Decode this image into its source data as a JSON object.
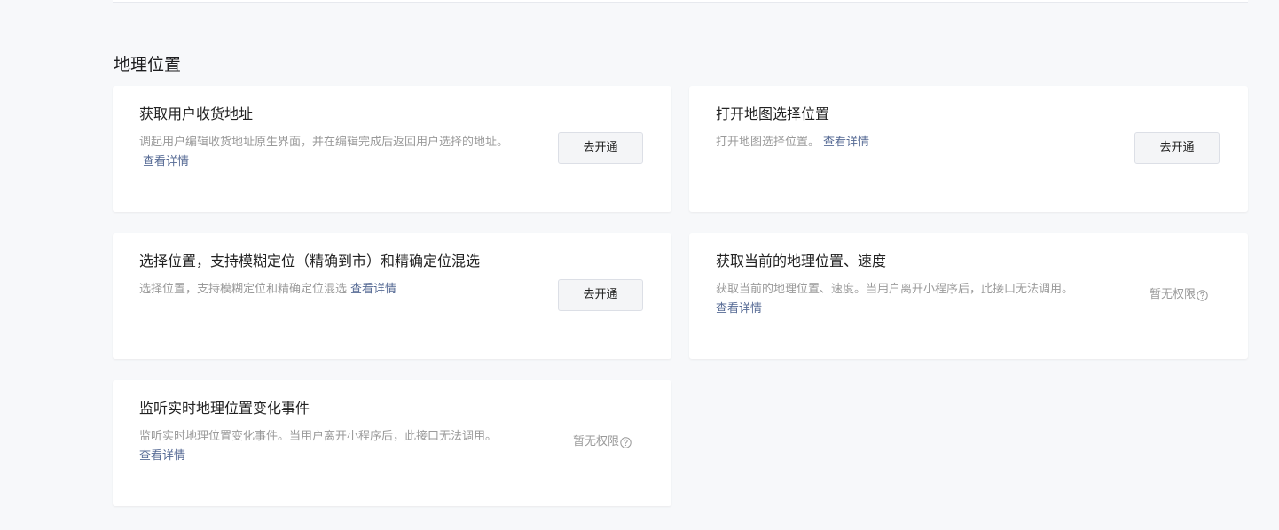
{
  "section": {
    "title": "地理位置"
  },
  "cards": [
    {
      "title": "获取用户收货地址",
      "desc": "调起用户编辑收货地址原生界面，并在编辑完成后返回用户选择的地址。",
      "link": "查看详情",
      "button": "去开通"
    },
    {
      "title": "打开地图选择位置",
      "desc": "打开地图选择位置。",
      "link": "查看详情",
      "button": "去开通"
    },
    {
      "title": "选择位置，支持模糊定位（精确到市）和精确定位混选",
      "desc": "选择位置，支持模糊定位和精确定位混选",
      "link": "查看详情",
      "button": "去开通"
    },
    {
      "title": "获取当前的地理位置、速度",
      "desc": "获取当前的地理位置、速度。当用户离开小程序后，此接口无法调用。",
      "link": "查看详情",
      "status": "暂无权限"
    },
    {
      "title": "监听实时地理位置变化事件",
      "desc": "监听实时地理位置变化事件。当用户离开小程序后，此接口无法调用。",
      "link": "查看详情",
      "status": "暂无权限"
    }
  ],
  "icons": {
    "help": "question-circle-icon"
  },
  "colors": {
    "link": "#576b95",
    "muted": "#9a9a9a",
    "background": "#f7f8fa"
  }
}
